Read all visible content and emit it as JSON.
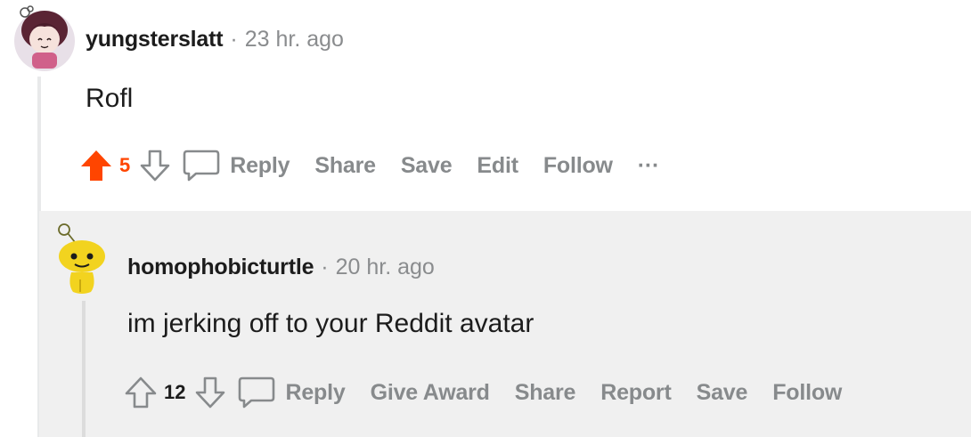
{
  "comments": [
    {
      "username": "yungsterslatt",
      "separator": "·",
      "time": "23 hr. ago",
      "body": "Rofl",
      "votes": "5",
      "vote_state": "upvoted",
      "actions": {
        "reply": "Reply",
        "share": "Share",
        "save": "Save",
        "edit": "Edit",
        "follow": "Follow",
        "more": "···"
      }
    },
    {
      "username": "homophobicturtle",
      "separator": "·",
      "time": "20 hr. ago",
      "body": "im jerking off to your Reddit avatar",
      "votes": "12",
      "vote_state": "none",
      "actions": {
        "reply": "Reply",
        "give_award": "Give Award",
        "share": "Share",
        "report": "Report",
        "save": "Save",
        "follow": "Follow"
      }
    }
  ],
  "icons": {
    "upvote_active": "upvote-arrow-filled",
    "upvote": "upvote-arrow-outline",
    "downvote": "downvote-arrow-outline",
    "comment": "speech-bubble",
    "avatar_1": "custom-reddit-avatar",
    "avatar_2": "default-snoo-avatar"
  },
  "colors": {
    "upvote_orange": "#ff4500",
    "muted_text": "#878a8c",
    "reply_background": "#f0f0f0",
    "snoo_yellow": "#f2d31f"
  }
}
